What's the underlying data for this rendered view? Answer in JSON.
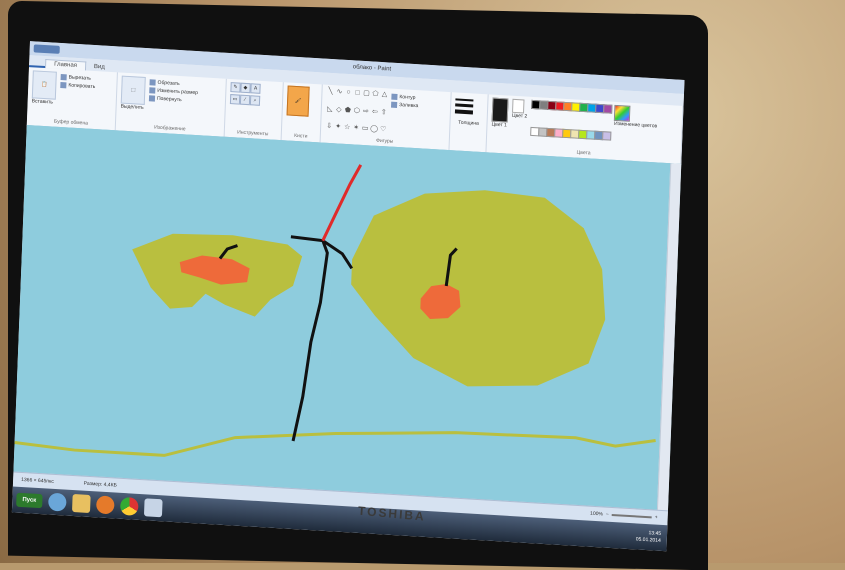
{
  "window": {
    "title": "облако - Paint"
  },
  "tabs": [
    {
      "label": ""
    },
    {
      "label": "Главная"
    },
    {
      "label": "Вид"
    }
  ],
  "ribbon": {
    "clipboard": {
      "paste": "Вставить",
      "cut": "Вырезать",
      "copy": "Копировать",
      "label": "Буфер обмена"
    },
    "image": {
      "select": "Выделить",
      "crop": "Обрезать",
      "resize": "Изменить размер",
      "rotate": "Повернуть",
      "label": "Изображение"
    },
    "tools": {
      "label": "Инструменты"
    },
    "brushes": {
      "label": "Кисти"
    },
    "shapes": {
      "outline": "Контур",
      "fill": "Заливка",
      "label": "Фигуры"
    },
    "size": {
      "label": "Толщина"
    },
    "colors": {
      "color1": "Цвет 1",
      "color2": "Цвет 2",
      "edit": "Изменение цветов",
      "label": "Цвета"
    },
    "palette": [
      "#000000",
      "#7f7f7f",
      "#880015",
      "#ed1c24",
      "#ff7f27",
      "#fff200",
      "#22b14c",
      "#00a2e8",
      "#3f48cc",
      "#a349a4",
      "#ffffff",
      "#c3c3c3",
      "#b97a57",
      "#ffaec9",
      "#ffc90e",
      "#efe4b0",
      "#b5e61d",
      "#99d9ea",
      "#7092be",
      "#c8bfe7"
    ]
  },
  "status": {
    "dimensions": "1366 × 645пкс",
    "filesize": "Размер: 4,4КБ",
    "zoom": "100%"
  },
  "taskbar": {
    "start": "Пуск",
    "time": "13:45",
    "date": "05.01.2014"
  },
  "laptop": {
    "brand": "TOSHIBA"
  },
  "colors": {
    "sky": "#8eccdd",
    "tree": "#b9bf3f",
    "apple": "#ee6a3a",
    "trunk": "#111111",
    "red_branch": "#e02a2a"
  }
}
